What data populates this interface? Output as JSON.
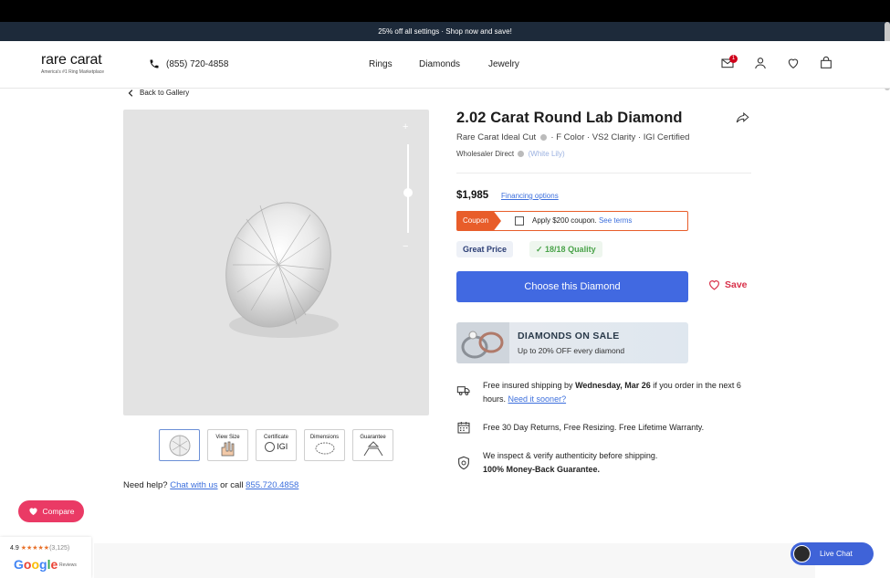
{
  "promo_bar": "25% off all settings · Shop now and save!",
  "header": {
    "logo_word": "rare carat",
    "logo_tagline": "America's #1 Ring Marketplace",
    "phone": "(855) 720-4858",
    "nav": [
      "Rings",
      "Diamonds",
      "Jewelry"
    ],
    "mail_badge": "1"
  },
  "back_link": "Back to Gallery",
  "gallery": {
    "zoom_plus": "+",
    "zoom_minus": "−",
    "zoom_level": 0.45,
    "thumbs": [
      {
        "label": ""
      },
      {
        "label": "View Size"
      },
      {
        "label": "Certificate"
      },
      {
        "label": "Dimensions"
      },
      {
        "label": "Guarantee"
      }
    ],
    "igi": "IGI"
  },
  "help": {
    "prefix": "Need help?",
    "chat": "Chat with us",
    "or_call": "or call",
    "phone": "855.720.4858"
  },
  "product": {
    "title": "2.02 Carat Round Lab Diamond",
    "cut": "Rare Carat Ideal Cut",
    "specs": "· F Color · VS2 Clarity · IGI Certified",
    "wholesaler": "Wholesaler Direct",
    "wholesaler_name": "(White Lily)",
    "price": "$1,985",
    "financing": "Financing options",
    "coupon_tag": "Coupon",
    "coupon_text": "Apply $200 coupon.",
    "coupon_link": "See terms",
    "badge_price": "Great Price",
    "badge_quality": "✓ 18/18 Quality",
    "choose_button": "Choose this Diamond",
    "save_label": "Save"
  },
  "sale_banner": {
    "heading": "DIAMONDS ON SALE",
    "sub": "Up to 20% OFF every diamond"
  },
  "features": {
    "shipping_a": "Free insured shipping by",
    "shipping_date": "Wednesday, Mar 26",
    "shipping_b": "if you order in the next 6 hours.",
    "shipping_link": "Need it sooner?",
    "returns": "Free 30 Day Returns, Free Resizing. Free Lifetime Warranty.",
    "inspect": "We inspect & verify authenticity before shipping.",
    "guarantee": "100% Money-Back Guarantee."
  },
  "compare_label": "Compare",
  "google": {
    "rating": "4.9",
    "stars": "★★★★★",
    "count": "(3,125)",
    "brand": "Google",
    "reviews": "Reviews"
  },
  "live_chat": "Live Chat",
  "colors": {
    "accent": "#4169e1",
    "coupon": "#e85d2a",
    "save": "#d8314a",
    "compare": "#ea3a65"
  }
}
